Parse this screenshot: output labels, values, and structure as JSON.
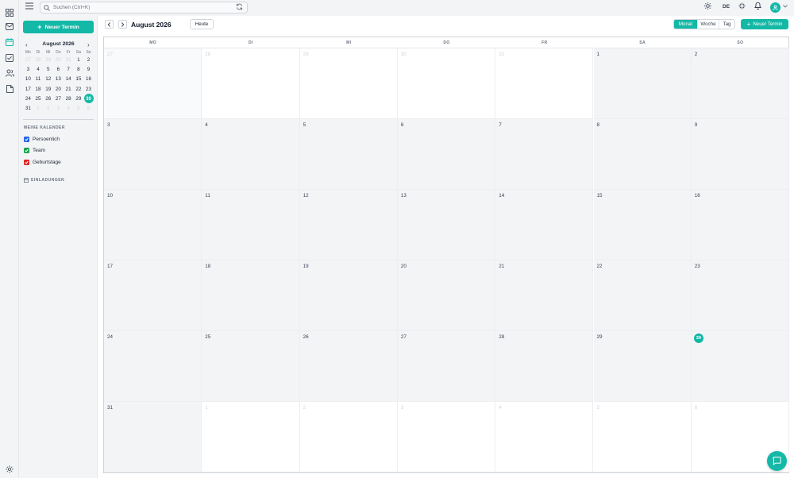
{
  "topbar": {
    "search_placeholder": "Suchen (Ctrl+K)",
    "language": "DE"
  },
  "sidebar": {
    "new_event_label": "Neuer Termin",
    "mini_calendar": {
      "title": "August 2026",
      "weekdays": [
        "Mo",
        "Di",
        "Mi",
        "Do",
        "Fr",
        "Sa",
        "So"
      ],
      "weeks": [
        [
          {
            "d": "27",
            "out": true
          },
          {
            "d": "28",
            "out": true
          },
          {
            "d": "29",
            "out": true
          },
          {
            "d": "30",
            "out": true
          },
          {
            "d": "31",
            "out": true
          },
          {
            "d": "1"
          },
          {
            "d": "2"
          }
        ],
        [
          {
            "d": "3"
          },
          {
            "d": "4"
          },
          {
            "d": "5"
          },
          {
            "d": "6"
          },
          {
            "d": "7"
          },
          {
            "d": "8"
          },
          {
            "d": "9"
          }
        ],
        [
          {
            "d": "10"
          },
          {
            "d": "11"
          },
          {
            "d": "12"
          },
          {
            "d": "13"
          },
          {
            "d": "14"
          },
          {
            "d": "15"
          },
          {
            "d": "16"
          }
        ],
        [
          {
            "d": "17"
          },
          {
            "d": "18"
          },
          {
            "d": "19"
          },
          {
            "d": "20"
          },
          {
            "d": "21"
          },
          {
            "d": "22"
          },
          {
            "d": "23"
          }
        ],
        [
          {
            "d": "24"
          },
          {
            "d": "25"
          },
          {
            "d": "26"
          },
          {
            "d": "27"
          },
          {
            "d": "28"
          },
          {
            "d": "29"
          },
          {
            "d": "30",
            "today": true
          }
        ],
        [
          {
            "d": "31"
          },
          {
            "d": "1",
            "out": true
          },
          {
            "d": "2",
            "out": true
          },
          {
            "d": "3",
            "out": true
          },
          {
            "d": "4",
            "out": true
          },
          {
            "d": "5",
            "out": true
          },
          {
            "d": "6",
            "out": true
          }
        ]
      ]
    },
    "my_calendars_label": "MEINE KALENDER",
    "calendars": [
      {
        "label": "Persoenlich",
        "color": "#2563eb"
      },
      {
        "label": "Team",
        "color": "#16a34a"
      },
      {
        "label": "Geburtstage",
        "color": "#dc2626"
      }
    ],
    "invitations_label": "EINLADUNGEN"
  },
  "main": {
    "title": "August 2026",
    "today_label": "Heute",
    "views": [
      {
        "label": "Monat",
        "active": true
      },
      {
        "label": "Woche",
        "active": false
      },
      {
        "label": "Tag",
        "active": false
      }
    ],
    "new_event_label": "Neuer Termin",
    "weekday_headers": [
      "MO",
      "DI",
      "MI",
      "DO",
      "FR",
      "SA",
      "SO"
    ],
    "weeks": [
      [
        {
          "d": "27",
          "out": true
        },
        {
          "d": "28",
          "out": true
        },
        {
          "d": "29",
          "out": true
        },
        {
          "d": "30",
          "out": true
        },
        {
          "d": "31",
          "out": true
        },
        {
          "d": "1"
        },
        {
          "d": "2"
        }
      ],
      [
        {
          "d": "3"
        },
        {
          "d": "4"
        },
        {
          "d": "5"
        },
        {
          "d": "6"
        },
        {
          "d": "7"
        },
        {
          "d": "8"
        },
        {
          "d": "9"
        }
      ],
      [
        {
          "d": "10"
        },
        {
          "d": "11"
        },
        {
          "d": "12"
        },
        {
          "d": "13"
        },
        {
          "d": "14"
        },
        {
          "d": "15"
        },
        {
          "d": "16"
        }
      ],
      [
        {
          "d": "17"
        },
        {
          "d": "18"
        },
        {
          "d": "19"
        },
        {
          "d": "20"
        },
        {
          "d": "21"
        },
        {
          "d": "22"
        },
        {
          "d": "23"
        }
      ],
      [
        {
          "d": "24"
        },
        {
          "d": "25"
        },
        {
          "d": "26"
        },
        {
          "d": "27"
        },
        {
          "d": "28"
        },
        {
          "d": "29"
        },
        {
          "d": "30",
          "today": true
        }
      ],
      [
        {
          "d": "31"
        },
        {
          "d": "1",
          "out": true
        },
        {
          "d": "2",
          "out": true
        },
        {
          "d": "3",
          "out": true
        },
        {
          "d": "4",
          "out": true
        },
        {
          "d": "5",
          "out": true
        },
        {
          "d": "6",
          "out": true
        }
      ]
    ]
  },
  "colors": {
    "accent": "#14b8a6"
  }
}
